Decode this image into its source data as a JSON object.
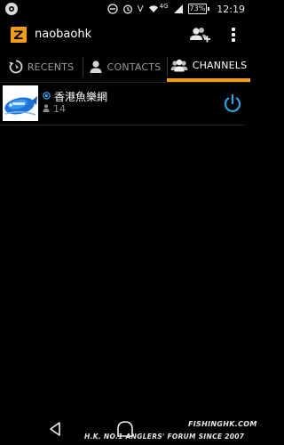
{
  "status_bar": {
    "network_type": "4G",
    "battery": "73%",
    "time": "12:19",
    "icons": [
      "notification-badge-icon",
      "do-not-disturb-icon",
      "alarm-icon",
      "volte-icon",
      "wifi-icon",
      "signal-icon",
      "battery-icon"
    ]
  },
  "app": {
    "title": "naobaohk",
    "accent": "#f09c1a",
    "logo_icon": "zello-logo-icon"
  },
  "tabs": [
    {
      "label": "RECENTS",
      "icon": "recents-icon",
      "active": false
    },
    {
      "label": "CONTACTS",
      "icon": "contact-person-icon",
      "active": false
    },
    {
      "label": "CHANNELS",
      "icon": "channels-group-icon",
      "active": true
    }
  ],
  "channels": [
    {
      "name": "香港魚樂網",
      "members": "14",
      "status": "online",
      "power_color": "#2ba4e0"
    }
  ],
  "watermark": {
    "site": "FISHINGHK.COM",
    "slogan": "H.K. NO.1 ANGLERS' FORUM SINCE 2007"
  }
}
